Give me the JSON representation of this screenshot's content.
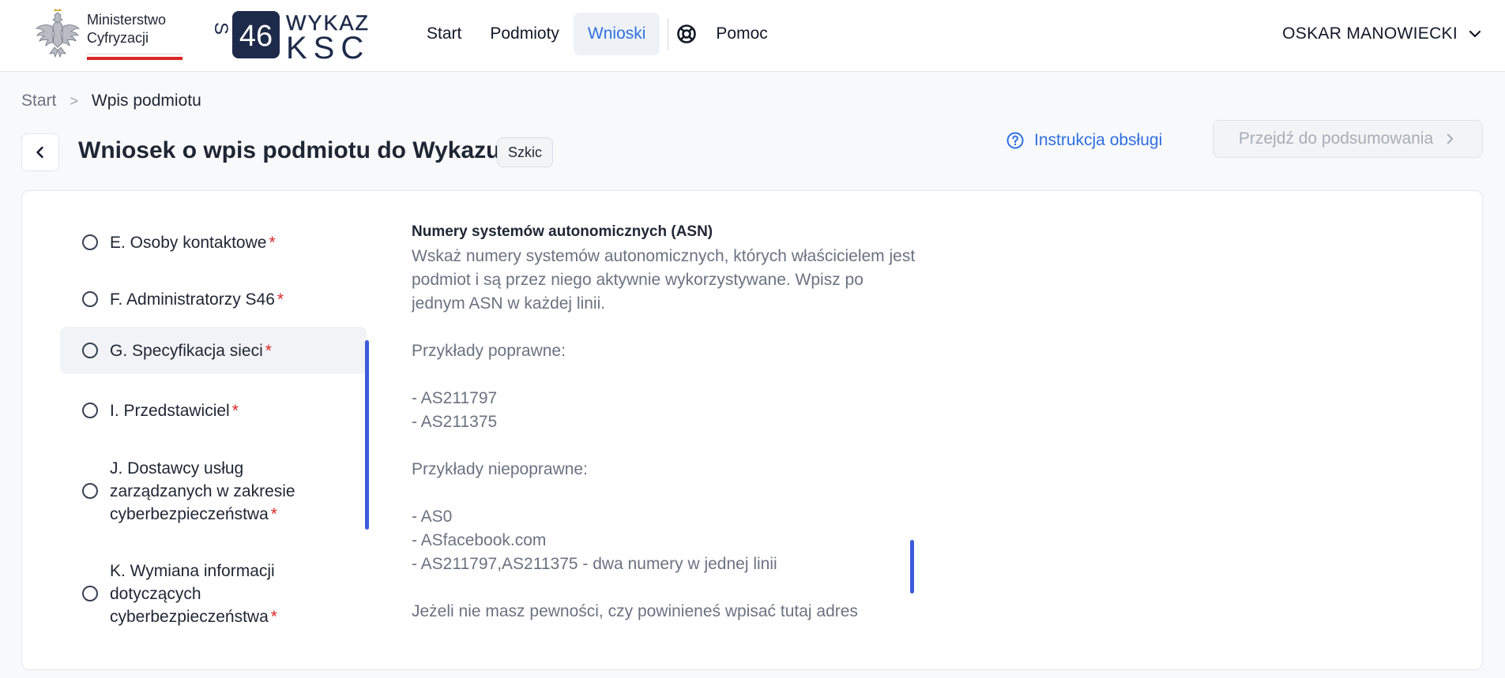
{
  "header": {
    "ministry_line1": "Ministerstwo",
    "ministry_line2": "Cyfryzacji",
    "logo_s": "S",
    "logo_46": "46",
    "logo_wykaz": "WYKAZ",
    "logo_ksc": "KSC",
    "nav": {
      "start": "Start",
      "entities": "Podmioty",
      "applications": "Wnioski",
      "help": "Pomoc"
    },
    "user_name": "OSKAR MANOWIECKI"
  },
  "breadcrumb": {
    "home": "Start",
    "separator": ">",
    "current": "Wpis podmiotu"
  },
  "page": {
    "title": "Wniosek o wpis podmiotu do Wykazu",
    "status": "Szkic",
    "manual_link": "Instrukcja obsługi",
    "summary_button": "Przejdź do podsumowania"
  },
  "steps": [
    {
      "label": "E. Osoby kontaktowe",
      "required": "*"
    },
    {
      "label": "F. Administratorzy S46",
      "required": "*"
    },
    {
      "label": "G. Specyfikacja sieci",
      "required": "*"
    },
    {
      "label": "I. Przedstawiciel",
      "required": "*"
    },
    {
      "label": "J. Dostawcy usług zarządzanych w zakresie cyberbezpieczeństwa",
      "required": "*"
    },
    {
      "label": "K. Wymiana informacji dotyczących cyberbezpieczeństwa",
      "required": "*"
    }
  ],
  "selected_step": "G. Specyfikacja sieci",
  "field": {
    "title": "Numery systemów autonomicznych (ASN)",
    "description": "Wskaż numery systemów autonomicznych, których właścicielem jest podmiot i są przez niego aktywnie wykorzystywane. Wpisz po jednym ASN w każdej linii.\n\nPrzykłady poprawne:\n\n- AS211797\n- AS211375\n\nPrzykłady niepoprawne:\n\n- AS0\n- ASfacebook.com\n- AS211797,AS211375 - dwa numery w jednej linii\n\nJeżeli nie masz pewności, czy powinieneś wpisać tutaj adres"
  },
  "colors": {
    "accent": "#2f6fe0",
    "required": "#dc2626",
    "scrollbar": "#3b5bdb",
    "logo_navy": "#1e2a4a"
  }
}
